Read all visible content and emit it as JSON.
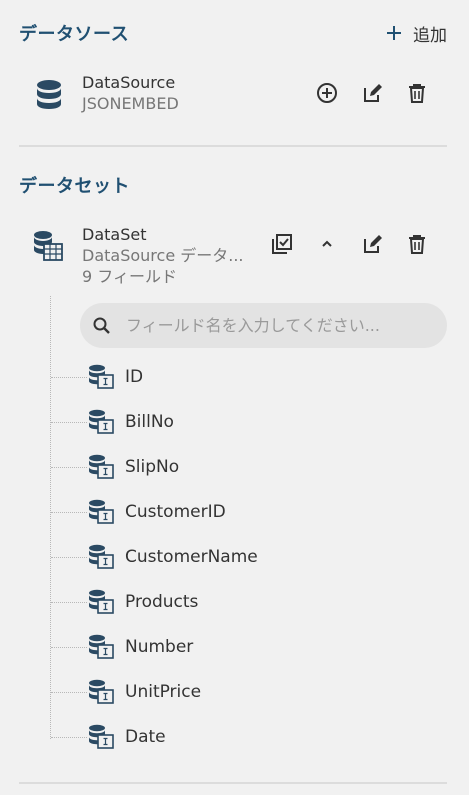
{
  "datasource_section": {
    "title": "データソース",
    "add_label": "追加"
  },
  "datasource_item": {
    "name": "DataSource",
    "type": "JSONEMBED"
  },
  "dataset_section": {
    "title": "データセット"
  },
  "dataset_item": {
    "name": "DataSet",
    "source": "DataSource データ...",
    "field_count": "9 フィールド"
  },
  "search": {
    "placeholder": "フィールド名を入力してください..."
  },
  "fields": [
    "ID",
    "BillNo",
    "SlipNo",
    "CustomerID",
    "CustomerName",
    "Products",
    "Number",
    "UnitPrice",
    "Date"
  ],
  "colors": {
    "accent": "#205072",
    "icon": "#2b4a63"
  }
}
